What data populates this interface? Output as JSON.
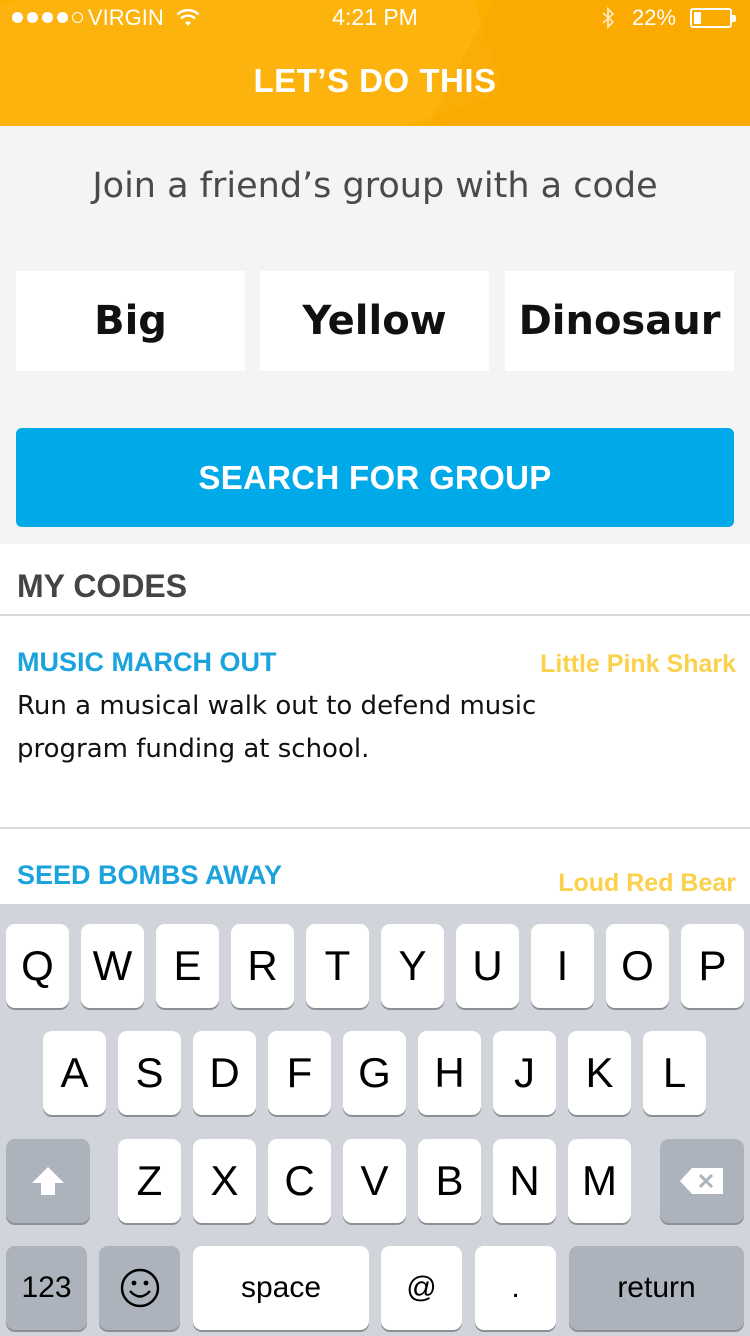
{
  "status_bar": {
    "carrier": "VIRGIN",
    "time": "4:21 PM",
    "battery": "22%",
    "battery_level": 0.22,
    "signal_bars": 4
  },
  "header": {
    "title": "LET’S DO THIS",
    "color": "#fbb000"
  },
  "join": {
    "prompt": "Join a friend’s group with a code",
    "words": [
      "Big",
      "Yellow",
      "Dinosaur"
    ],
    "search_button": "SEARCH FOR GROUP",
    "button_color": "#00a9e8"
  },
  "my_codes": {
    "heading": "MY CODES",
    "items": [
      {
        "title": "MUSIC MARCH OUT",
        "code": "Little Pink Shark",
        "desc_line1": "Run a musical walk out to defend music",
        "desc_line2": "program funding at school."
      },
      {
        "title": "SEED BOMBS AWAY",
        "code": "Loud Red Bear"
      }
    ],
    "title_color": "#1aa3dc",
    "code_color": "#fbd04a"
  },
  "keyboard": {
    "row1": [
      "Q",
      "W",
      "E",
      "R",
      "T",
      "Y",
      "U",
      "I",
      "O",
      "P"
    ],
    "row2": [
      "A",
      "S",
      "D",
      "F",
      "G",
      "H",
      "J",
      "K",
      "L"
    ],
    "row3": [
      "Z",
      "X",
      "C",
      "V",
      "B",
      "N",
      "M"
    ],
    "numbers": "123",
    "space": "space",
    "at": "@",
    "period": ".",
    "return": "return"
  }
}
